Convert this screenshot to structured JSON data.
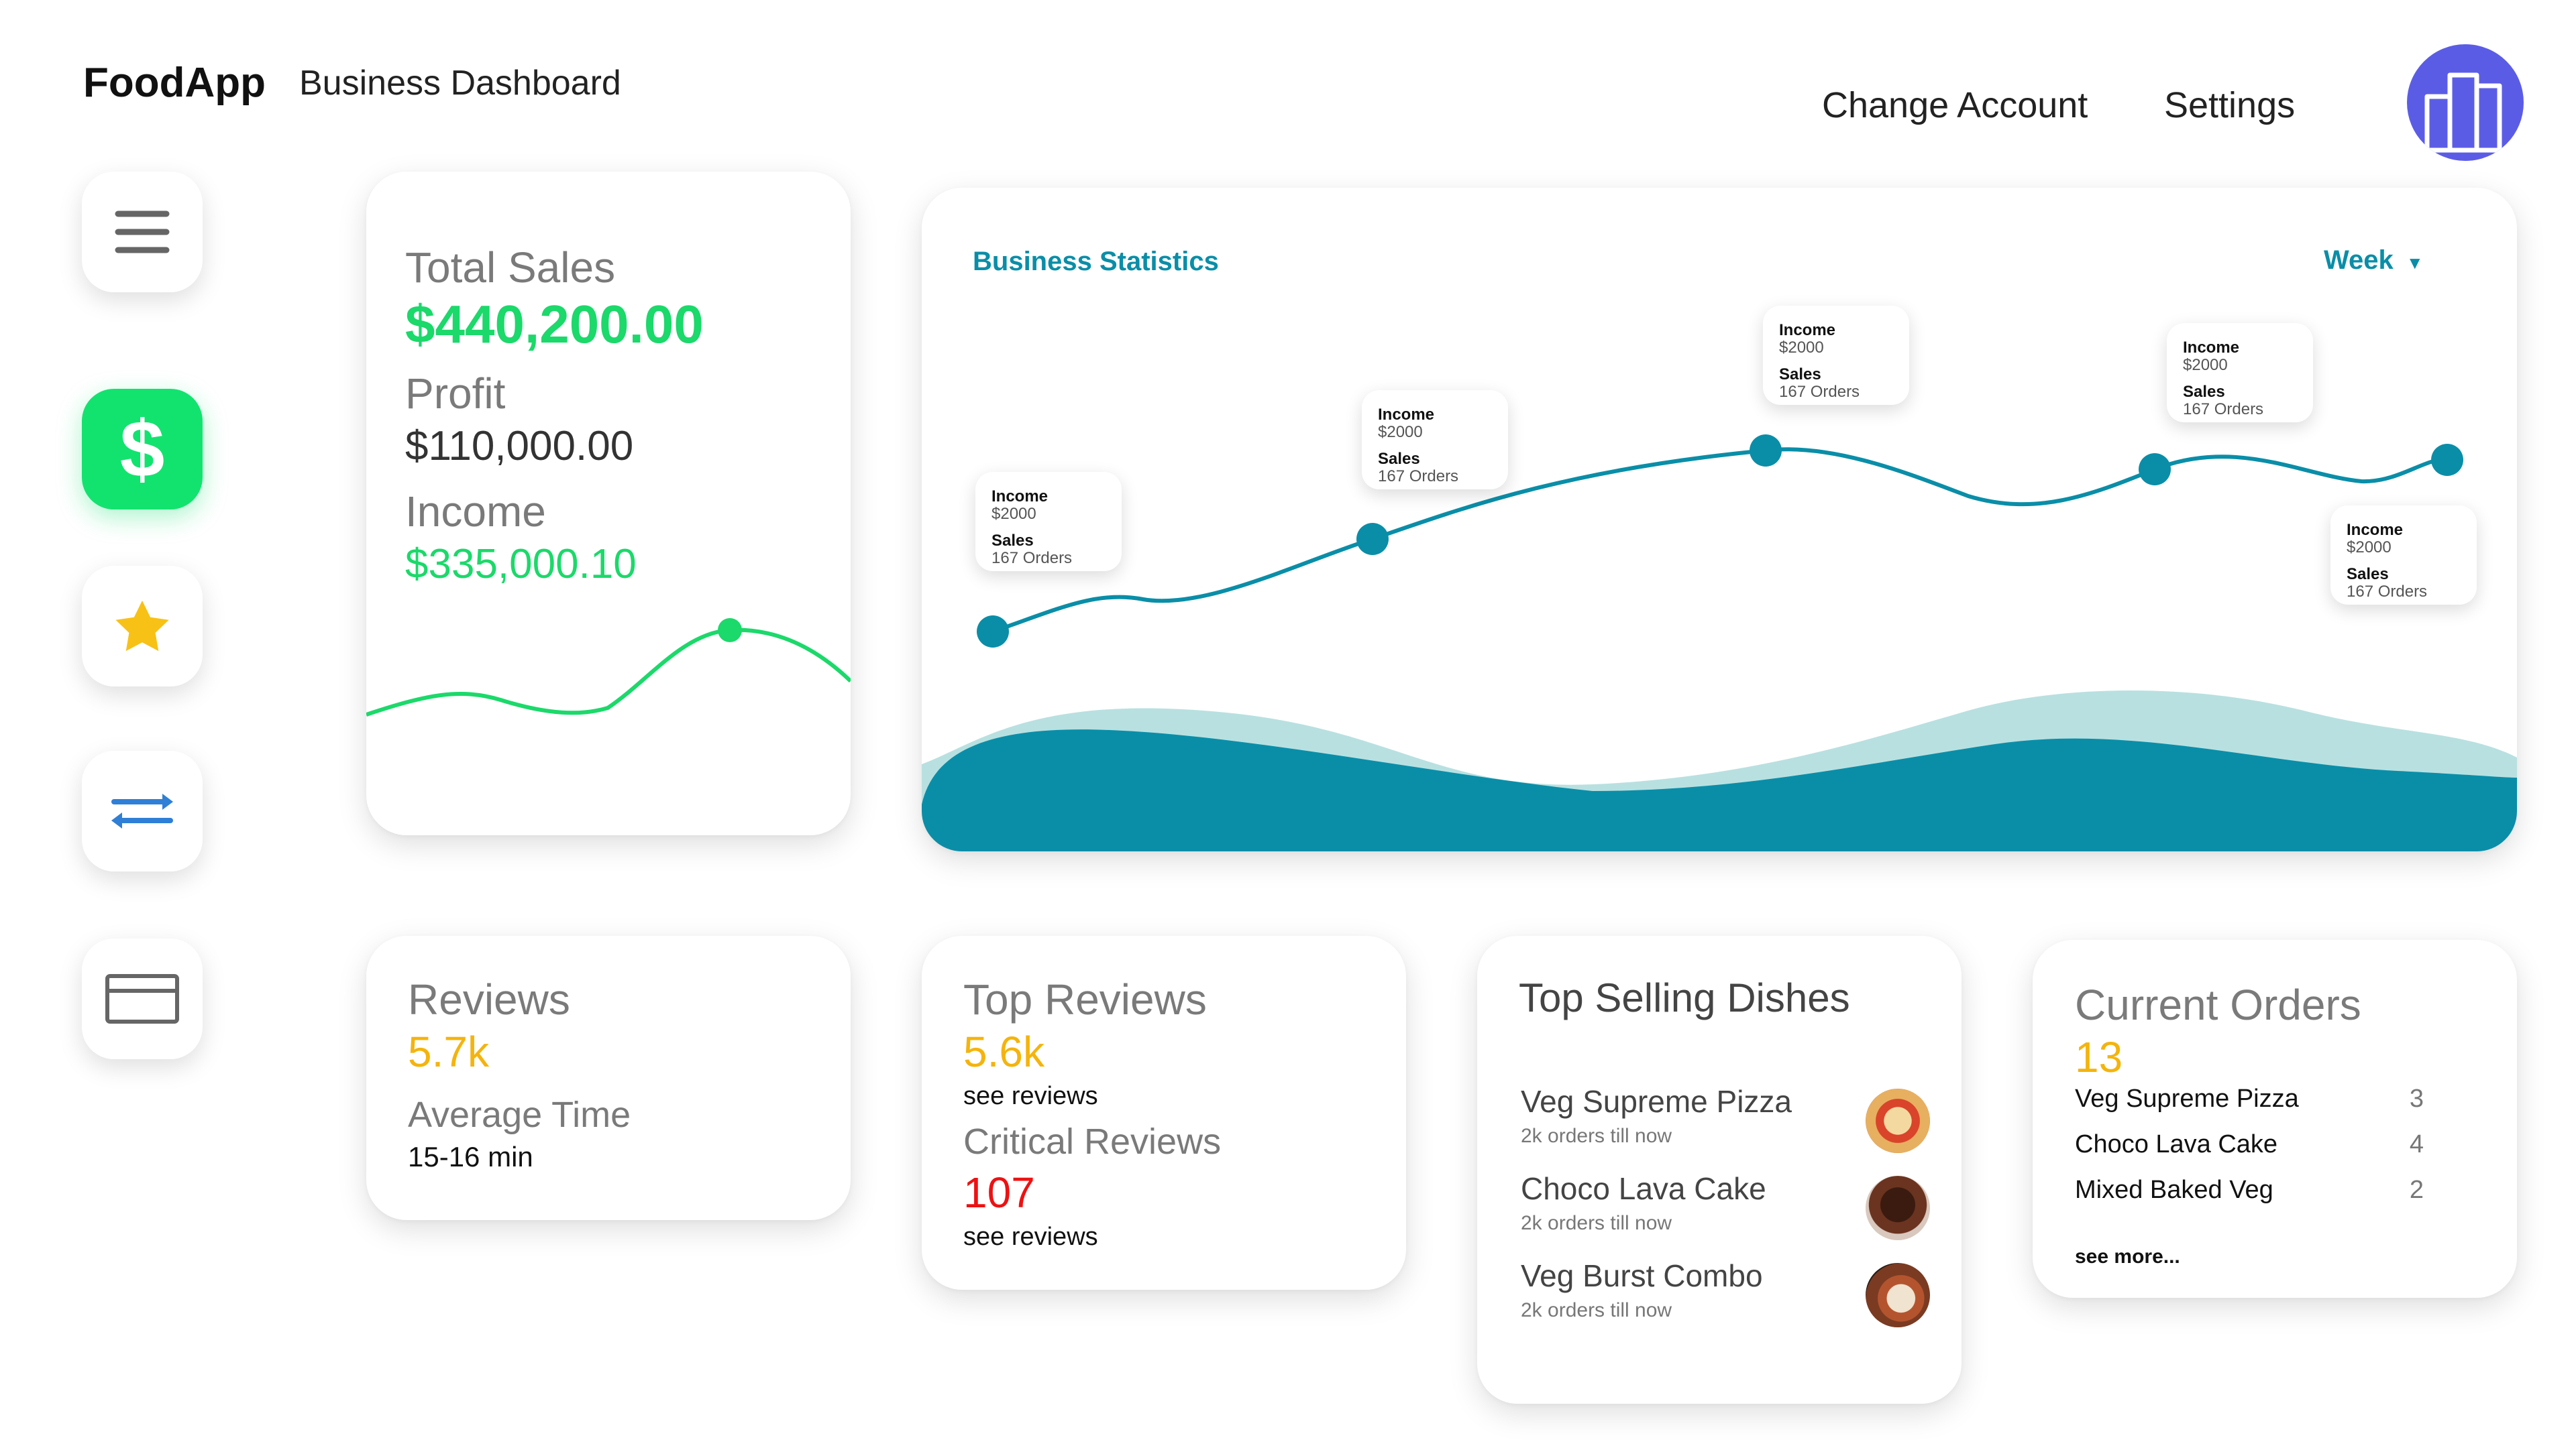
{
  "header": {
    "brand": "FoodApp",
    "subtitle": "Business Dashboard",
    "nav": [
      "Change Account",
      "Settings"
    ]
  },
  "sidebar": {
    "items": [
      {
        "icon": "menu-icon",
        "active": false
      },
      {
        "icon": "dollar-icon",
        "active": true,
        "glyph": "$"
      },
      {
        "icon": "star-icon",
        "active": false
      },
      {
        "icon": "transfer-icon",
        "active": false
      },
      {
        "icon": "card-icon",
        "active": false
      }
    ]
  },
  "summary": {
    "total_sales_label": "Total Sales",
    "total_sales": "$440,200.00",
    "profit_label": "Profit",
    "profit": "$110,000.00",
    "income_label": "Income",
    "income": "$335,000.10"
  },
  "stats": {
    "title": "Business Statistics",
    "period": "Week",
    "tooltips": [
      {
        "income_label": "Income",
        "income": "$2000",
        "sales_label": "Sales",
        "sales": "167 Orders"
      },
      {
        "income_label": "Income",
        "income": "$2000",
        "sales_label": "Sales",
        "sales": "167 Orders"
      },
      {
        "income_label": "Income",
        "income": "$2000",
        "sales_label": "Sales",
        "sales": "167 Orders"
      },
      {
        "income_label": "Income",
        "income": "$2000",
        "sales_label": "Sales",
        "sales": "167 Orders"
      },
      {
        "income_label": "Income",
        "income": "$2000",
        "sales_label": "Sales",
        "sales": "167 Orders"
      }
    ]
  },
  "reviews": {
    "label": "Reviews",
    "value": "5.7k",
    "avg_label": "Average Time",
    "avg_value": "15-16 min"
  },
  "top_reviews": {
    "label": "Top Reviews",
    "value": "5.6k",
    "link": "see reviews",
    "critical_label": "Critical Reviews",
    "critical_value": "107",
    "critical_link": "see reviews"
  },
  "top_dishes": {
    "title": "Top Selling Dishes",
    "items": [
      {
        "name": "Veg Supreme Pizza",
        "sub": "2k orders till now",
        "icon": "pizza-icon"
      },
      {
        "name": "Choco Lava Cake",
        "sub": "2k orders till now",
        "icon": "cake-icon"
      },
      {
        "name": "Veg Burst Combo",
        "sub": "2k orders till now",
        "icon": "combo-icon"
      }
    ]
  },
  "current_orders": {
    "title": "Current Orders",
    "count": "13",
    "items": [
      {
        "name": "Veg Supreme Pizza",
        "qty": "3"
      },
      {
        "name": "Choco Lava Cake",
        "qty": "4"
      },
      {
        "name": "Mixed Baked Veg",
        "qty": "2"
      }
    ],
    "more": "see more..."
  },
  "colors": {
    "accent_green": "#1bd96a",
    "teal": "#0a8ea8",
    "orange": "#f5b40c",
    "red": "#ee1111",
    "avatar": "#5b5ce6"
  }
}
